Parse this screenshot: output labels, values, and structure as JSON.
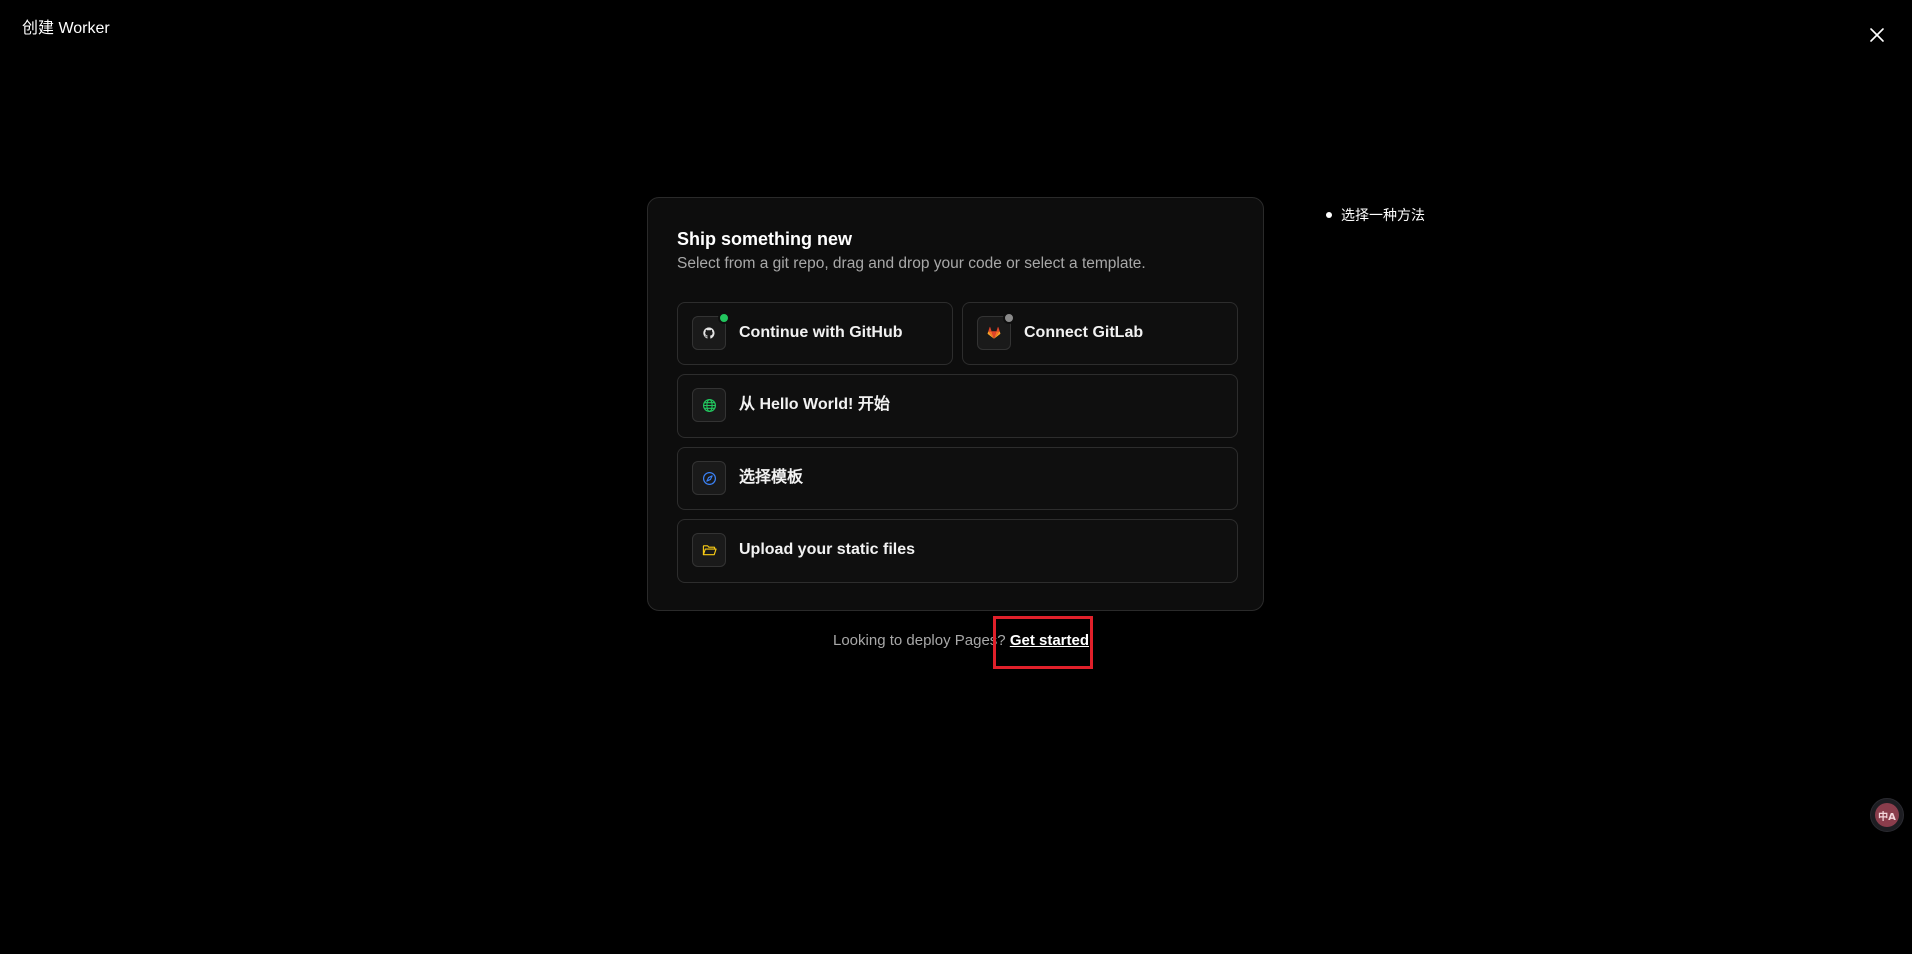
{
  "header": {
    "title": "创建 Worker",
    "close_icon": "close-icon"
  },
  "card": {
    "title": "Ship something new",
    "subtitle": "Select from a git repo, drag and drop your code or select a template.",
    "options": [
      {
        "label": "Continue with GitHub",
        "icon": "github-icon",
        "status_color": "#22c55e"
      },
      {
        "label": "Connect GitLab",
        "icon": "gitlab-icon",
        "status_color": "#8a8a8a"
      },
      {
        "label": "从 Hello World! 开始",
        "icon": "globe-icon",
        "icon_color": "#22c55e"
      },
      {
        "label": "选择模板",
        "icon": "compass-icon",
        "icon_color": "#3b82f6"
      },
      {
        "label": "Upload your static files",
        "icon": "folder-icon",
        "icon_color": "#facc15"
      }
    ]
  },
  "pages_prompt": {
    "text": "Looking to deploy Pages?",
    "link_label": "Get started",
    "highlight_color": "#e0202a"
  },
  "steps": {
    "items": [
      {
        "label": "选择一种方法"
      }
    ]
  },
  "translate_widget": {
    "label": "中A"
  }
}
